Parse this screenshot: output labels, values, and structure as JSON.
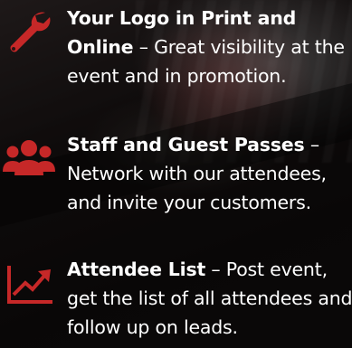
{
  "features": [
    {
      "title": "Your Logo in Print and Online",
      "separator": "  –",
      "description": " Great visibility at the event and in promotion.",
      "icon": "wrench-icon"
    },
    {
      "title": "Staff and Guest Passes",
      "separator": " –",
      "description": " Network with our attendees, and invite your customers.",
      "icon": "users-group-icon"
    },
    {
      "title": "Attendee List",
      "separator": " –",
      "description": " Post event, get the list of all attendees and follow up on leads.",
      "icon": "trending-chart-icon"
    }
  ],
  "colors": {
    "accent": "#c62828",
    "text": "#ffffff"
  }
}
